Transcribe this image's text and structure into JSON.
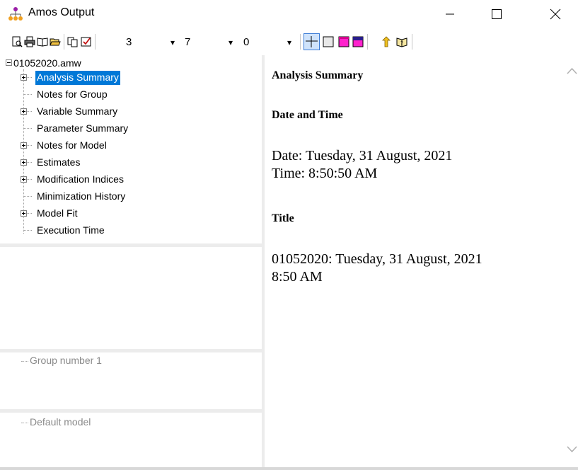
{
  "window": {
    "title": "Amos Output",
    "icon": "amos-app-icon",
    "controls": [
      "minimize-icon",
      "maximize-icon",
      "close-icon"
    ]
  },
  "toolbar": {
    "icons": [
      "print-preview-icon",
      "print-icon",
      "page-setup-icon",
      "open-icon",
      "copy-icon",
      "options-icon"
    ],
    "decimals_value": "3",
    "column_width_value": "7",
    "table_columns_value": "0",
    "view_icons": [
      "table-rules-icon",
      "table-border-icon",
      "table-fill-icon",
      "table-header-icon",
      "up-arrow-icon",
      "help-book-icon"
    ]
  },
  "tree": {
    "root": "01052020.amw",
    "items": [
      {
        "label": "Analysis Summary",
        "expandable": true,
        "selected": true
      },
      {
        "label": "Notes for Group",
        "expandable": false,
        "selected": false
      },
      {
        "label": "Variable Summary",
        "expandable": true,
        "selected": false
      },
      {
        "label": "Parameter Summary",
        "expandable": false,
        "selected": false
      },
      {
        "label": "Notes for Model",
        "expandable": true,
        "selected": false
      },
      {
        "label": "Estimates",
        "expandable": true,
        "selected": false
      },
      {
        "label": "Modification Indices",
        "expandable": true,
        "selected": false
      },
      {
        "label": "Minimization History",
        "expandable": false,
        "selected": false
      },
      {
        "label": "Model Fit",
        "expandable": true,
        "selected": false
      },
      {
        "label": "Execution Time",
        "expandable": false,
        "selected": false
      }
    ]
  },
  "groups_pane": {
    "item": "Group number 1"
  },
  "models_pane": {
    "item": "Default model"
  },
  "content": {
    "heading": "Analysis Summary",
    "date_time_heading": "Date and Time",
    "date_line": "Date: Tuesday, 31 August, 2021",
    "time_line": "Time: 8:50:50 AM",
    "title_heading": "Title",
    "title_line1": "01052020: Tuesday, 31 August, 2021",
    "title_line2": "8:50 AM"
  },
  "colors": {
    "selection": "#0078d7",
    "pane_divider": "#ececec",
    "disabled_text": "#8a8a8a"
  }
}
